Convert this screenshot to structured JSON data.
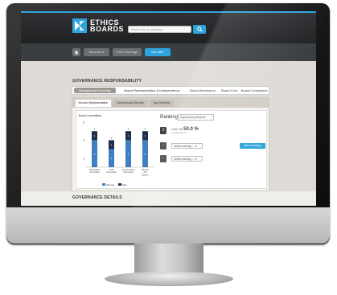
{
  "app": {
    "logo_line1": "ETHICS",
    "logo_line2": "BOARDS",
    "search_placeholder": "Search for a company",
    "search_button_icon": "search-icon",
    "accent_color": "#2ea4dc"
  },
  "nav": {
    "home_icon": "home-icon",
    "items": [
      "Structure ▾",
      "ESG Rankings",
      "Our offer"
    ],
    "active_index": 2
  },
  "governance": {
    "section_title": "GOVERNANCE RESPONSABILITY",
    "tabs": [
      "Management Diversity",
      "Board Representation & Independence",
      "Board Attendance",
      "Board Cost",
      "Board Compliance"
    ],
    "active_tab": 0,
    "subtabs": [
      "Women Representation",
      "International Diversity",
      "Age Diversity"
    ],
    "active_subtab": 0
  },
  "chart_data": {
    "type": "bar",
    "title": "Board committees",
    "categories": [
      "Nominating Committee",
      "Audit Committee",
      "Compensation Committee",
      "Director (All Board)"
    ],
    "stacked": true,
    "series": [
      {
        "name": "Women",
        "color": "#3f7fc0",
        "values": [
          3,
          2,
          3,
          3
        ]
      },
      {
        "name": "Men",
        "color": "#1f2f4a",
        "values": [
          1,
          1,
          1,
          1
        ]
      }
    ],
    "ylim": [
      0,
      5
    ],
    "y_ticks": [
      1,
      3,
      5
    ],
    "legend": "bottom"
  },
  "ranking": {
    "label": "Ranking",
    "select_value": "Supervisory Board",
    "rows": [
      {
        "rank": "1",
        "company": "CAC 40",
        "value": "50.0 %",
        "note": "Average 23.5 %"
      },
      {
        "rank": "-",
        "select": "Select ranking"
      },
      {
        "rank": "-",
        "select": "Select ranking"
      }
    ],
    "button_label": "View ranking"
  },
  "footer": {
    "section_title": "GOVERNANCE DETAILS"
  }
}
